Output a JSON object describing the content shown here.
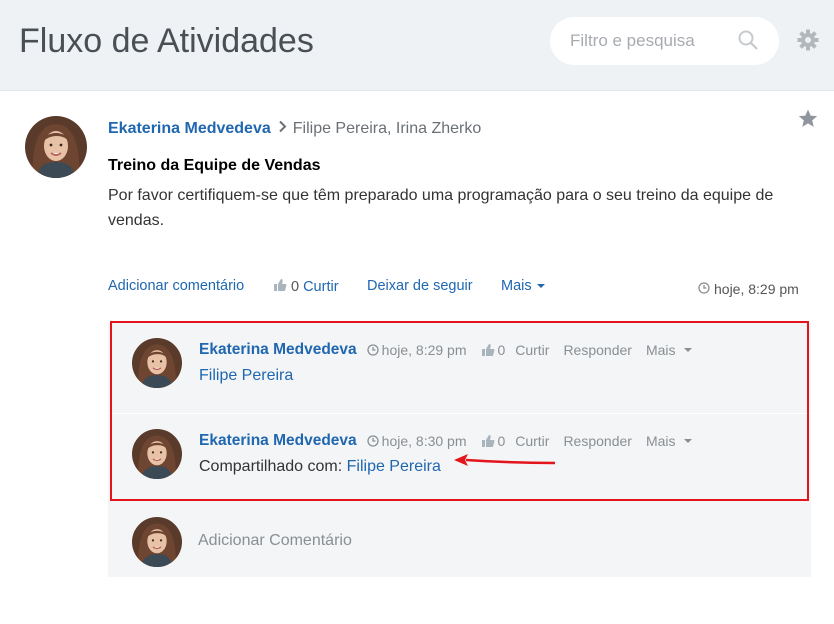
{
  "header": {
    "title": "Fluxo de Atividades",
    "search_placeholder": "Filtro e pesquisa",
    "search_icon": "search-icon",
    "settings_icon": "gear-icon"
  },
  "post": {
    "author": "Ekaterina Medvedeva",
    "recipients": "Filipe Pereira, Irina Zherko",
    "title": "Treino da Equipe de Vendas",
    "body": "Por favor certifiquem-se que têm preparado uma programação para o seu treino da equipe de vendas.",
    "actions": {
      "add_comment": "Adicionar comentário",
      "like_count": "0",
      "like": "Curtir",
      "unfollow": "Deixar de seguir",
      "more": "Mais"
    },
    "time": "hoje, 8:29 pm"
  },
  "comments": [
    {
      "author": "Ekaterina Medvedeva",
      "time": "hoje, 8:29 pm",
      "like_count": "0",
      "like": "Curtir",
      "reply": "Responder",
      "more": "Mais",
      "body_prefix": "",
      "body_link": "Filipe Pereira"
    },
    {
      "author": "Ekaterina Medvedeva",
      "time": "hoje, 8:30 pm",
      "like_count": "0",
      "like": "Curtir",
      "reply": "Responder",
      "more": "Mais",
      "body_prefix": "Compartilhado com:",
      "body_link": "Filipe Pereira"
    }
  ],
  "add_comment_placeholder": "Adicionar Comentário",
  "colors": {
    "link": "#2067b0",
    "highlight": "#e3141b",
    "header_bg": "#eef2f4"
  }
}
